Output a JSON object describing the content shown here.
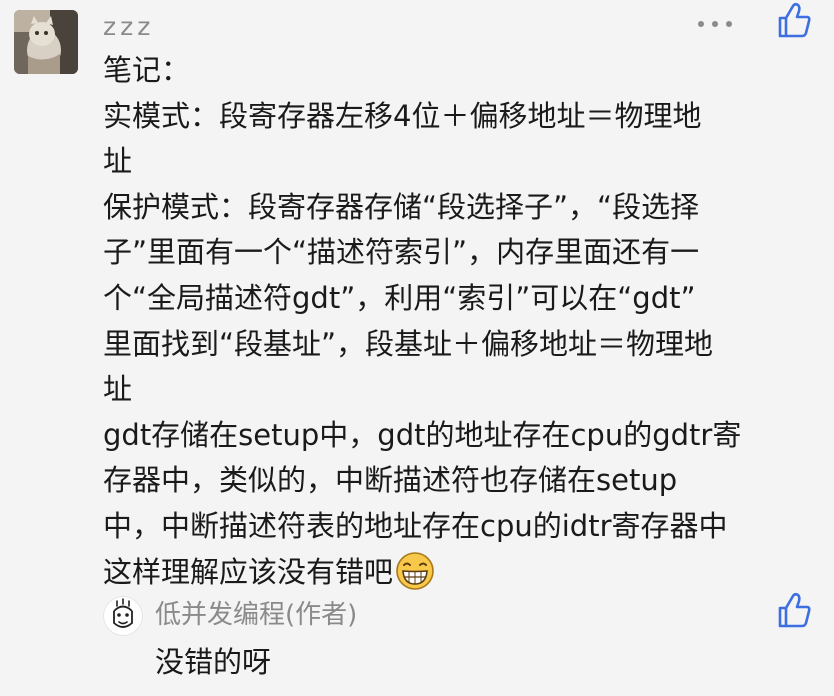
{
  "comment": {
    "username": "zzz",
    "lines": [
      "笔记：",
      "实模式：段寄存器左移4位＋偏移地址＝物理地",
      "址",
      "保护模式：段寄存器存储“段选择子”，“段选择",
      "子”里面有一个“描述符索引”，内存里面还有一",
      "个“全局描述符gdt”，利用“索引”可以在“gdt”",
      "里面找到“段基址”，段基址＋偏移地址＝物理地",
      "址",
      "gdt存储在setup中，gdt的地址存在cpu的gdtr寄",
      "存器中，类似的，中断描述符也存储在setup",
      "中，中断描述符表的地址存在cpu的idtr寄存器中",
      "这样理解应该没有错吧"
    ],
    "emoji": "grinning-face-emoji"
  },
  "reply": {
    "author": "低并发编程(作者)",
    "text": "没错的呀"
  },
  "icons": {
    "more": "more-horizontal-icon",
    "like": "thumbs-up-icon"
  },
  "colors": {
    "background": "#f4f4f4",
    "text": "#1a1a1a",
    "meta": "#8a8a8a",
    "accent": "#3d6fe0"
  }
}
